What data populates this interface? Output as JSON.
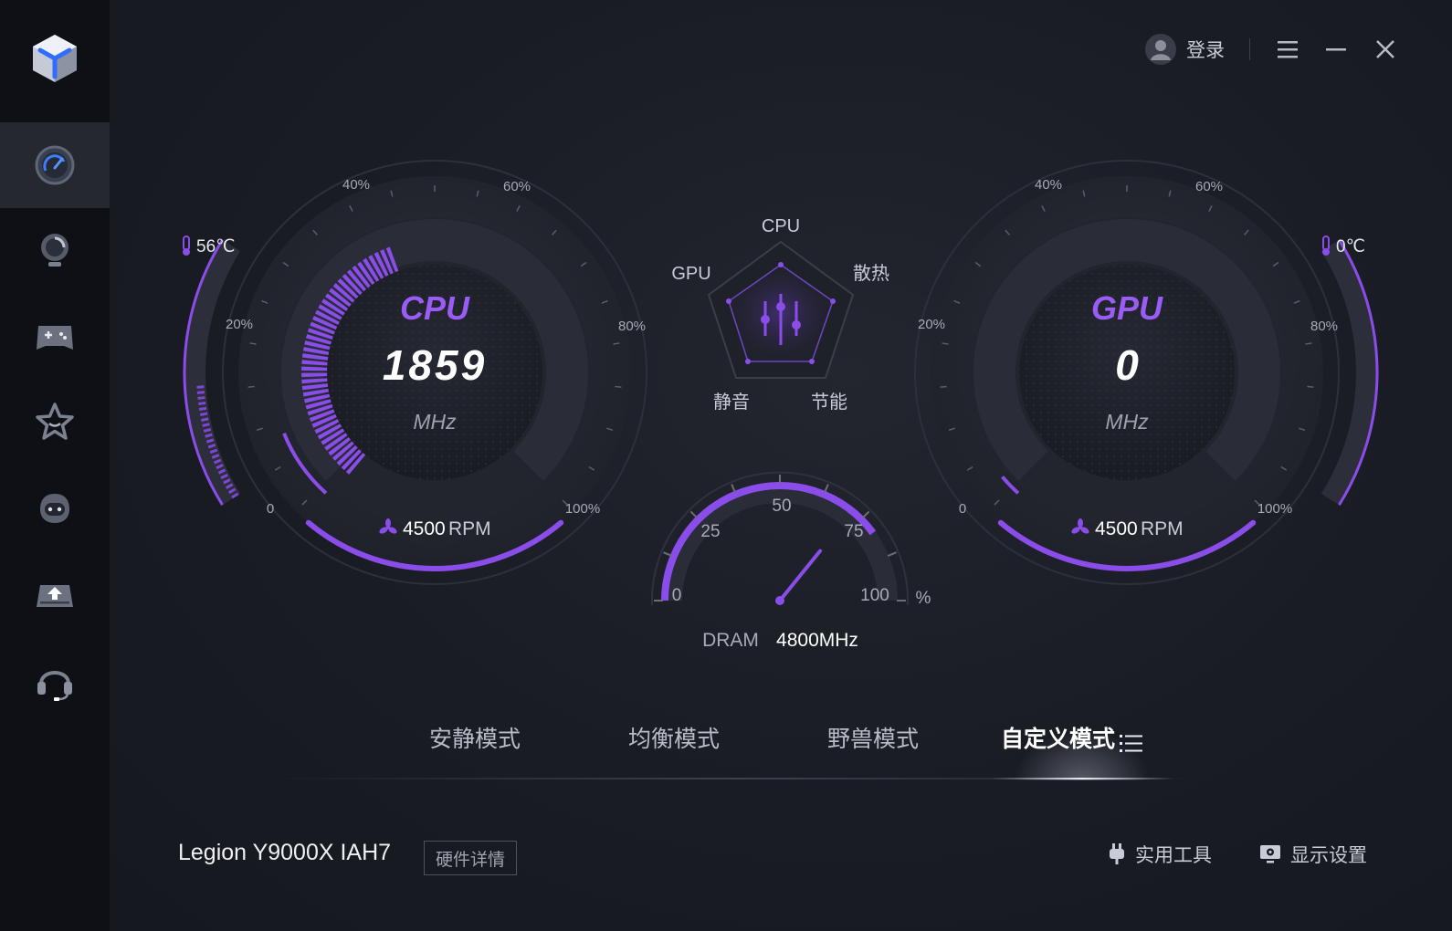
{
  "topbar": {
    "login_label": "登录"
  },
  "cpu": {
    "title": "CPU",
    "frequency": "1859",
    "unit": "MHz",
    "temperature": "56℃",
    "fan_speed": "4500",
    "fan_unit": "RPM",
    "ticks": [
      "0",
      "20%",
      "40%",
      "60%",
      "80%",
      "100%"
    ],
    "usage_fraction": 0.28,
    "temp_fraction": 0.45
  },
  "gpu": {
    "title": "GPU",
    "frequency": "0",
    "unit": "MHz",
    "temperature": "0℃",
    "fan_speed": "4500",
    "fan_unit": "RPM",
    "ticks": [
      "0",
      "20%",
      "40%",
      "60%",
      "80%",
      "100%"
    ]
  },
  "radar": {
    "labels": {
      "cpu": "CPU",
      "gpu": "GPU",
      "cooling": "散热",
      "quiet": "静音",
      "eco": "节能"
    }
  },
  "dram": {
    "label": "DRAM",
    "value": "4800MHz",
    "ticks": [
      "0",
      "25",
      "50",
      "75",
      "100"
    ],
    "unit": "%",
    "usage_percent": 80
  },
  "modes": {
    "tabs": [
      "安静模式",
      "均衡模式",
      "野兽模式",
      "自定义模式"
    ],
    "active_index": 3
  },
  "footer": {
    "device_name": "Legion Y9000X IAH7",
    "hardware_button": "硬件详情",
    "tools_label": "实用工具",
    "display_label": "显示设置"
  },
  "colors": {
    "accent": "#8a4dea",
    "accent_light": "#a36bff",
    "background": "#181a22",
    "sidebar": "#0f1015"
  },
  "icons": [
    "logo-cube-icon",
    "speedometer-icon",
    "lightbulb-icon",
    "gamepad-icon",
    "star-icon",
    "robot-icon",
    "cloud-upload-icon",
    "headset-icon",
    "user-avatar-icon",
    "menu-icon",
    "minimize-icon",
    "close-icon",
    "thermometer-icon",
    "fan-icon",
    "equalizer-icon",
    "list-icon",
    "plug-icon",
    "monitor-settings-icon"
  ]
}
